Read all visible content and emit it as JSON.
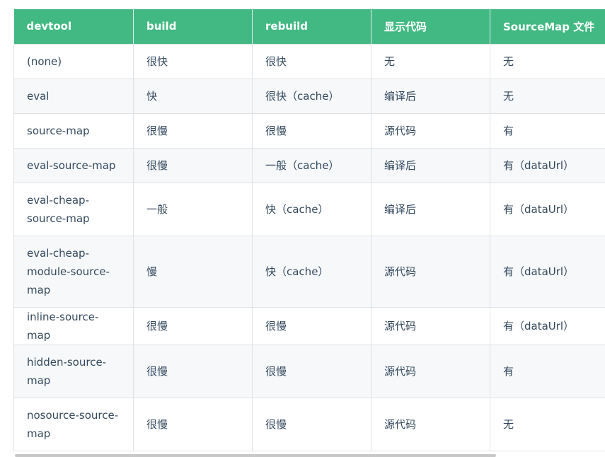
{
  "table": {
    "headers": [
      "devtool",
      "build",
      "rebuild",
      "显示代码",
      "SourceMap 文件"
    ],
    "rows": [
      [
        "(none)",
        "很快",
        "很快",
        "无",
        "无"
      ],
      [
        "eval",
        "快",
        "很快（cache）",
        "编译后",
        "无"
      ],
      [
        "source-map",
        "很慢",
        "很慢",
        "源代码",
        "有"
      ],
      [
        "eval-source-map",
        "很慢",
        "一般（cache）",
        "编译后",
        "有（dataUrl）"
      ],
      [
        "eval-cheap-source-map",
        "一般",
        "快（cache）",
        "编译后",
        "有（dataUrl）"
      ],
      [
        "eval-cheap-module-source-map",
        "慢",
        "快（cache）",
        "源代码",
        "有（dataUrl）"
      ],
      [
        "inline-source-map",
        "很慢",
        "很慢",
        "源代码",
        "有（dataUrl）"
      ],
      [
        "hidden-source-map",
        "很慢",
        "很慢",
        "源代码",
        "有"
      ],
      [
        "nosource-source-map",
        "很慢",
        "很慢",
        "源代码",
        "无"
      ]
    ]
  },
  "colors": {
    "header_bg": "#42b983",
    "header_text": "#ffffff",
    "body_text": "#34495e",
    "stripe": "#f6f8fa",
    "border": "#dfe2e5"
  }
}
